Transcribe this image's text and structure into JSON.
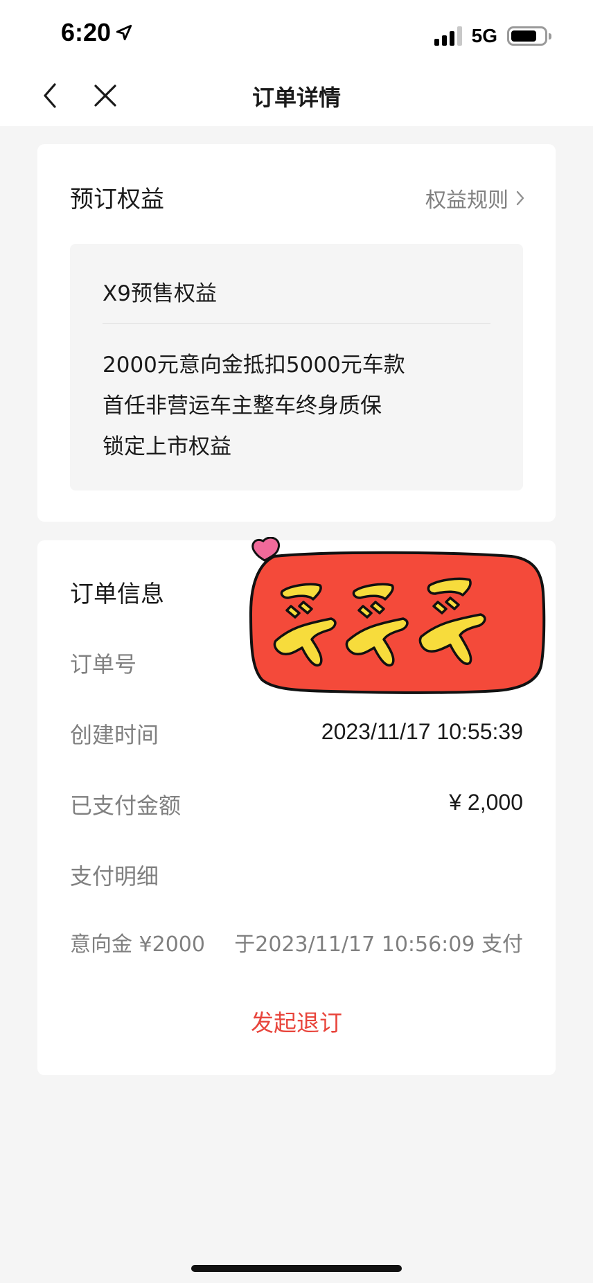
{
  "status_bar": {
    "time": "6:20",
    "network": "5G",
    "icons": [
      "location-arrow-icon",
      "signal-icon",
      "battery-icon"
    ]
  },
  "nav": {
    "title": "订单详情",
    "back_icon": "chevron-left-icon",
    "close_icon": "close-icon"
  },
  "benefits": {
    "section_title": "预订权益",
    "rules_link": "权益规则",
    "box_title": "X9预售权益",
    "items": [
      "2000元意向金抵扣5000元车款",
      "首任非营运车主整车终身质保",
      "锁定上市权益"
    ]
  },
  "order": {
    "section_title": "订单信息",
    "order_no_label": "订单号",
    "created_label": "创建时间",
    "created_value": "2023/11/17 10:55:39",
    "paid_label": "已支付金额",
    "paid_value": "¥ 2,000",
    "detail_label": "支付明细",
    "detail_item_label": "意向金 ¥2000",
    "detail_item_value": "于2023/11/17 10:56:09 支付",
    "refund_button": "发起退订"
  },
  "sticker": {
    "description_icon": "sticker-buy-icon",
    "colors": {
      "fill": "#f44a3a",
      "text": "#f7dc3c",
      "heart": "#f06a9a"
    }
  },
  "colors": {
    "accent_red": "#e8453c",
    "muted_text": "#808080",
    "page_bg": "#f5f5f5"
  }
}
